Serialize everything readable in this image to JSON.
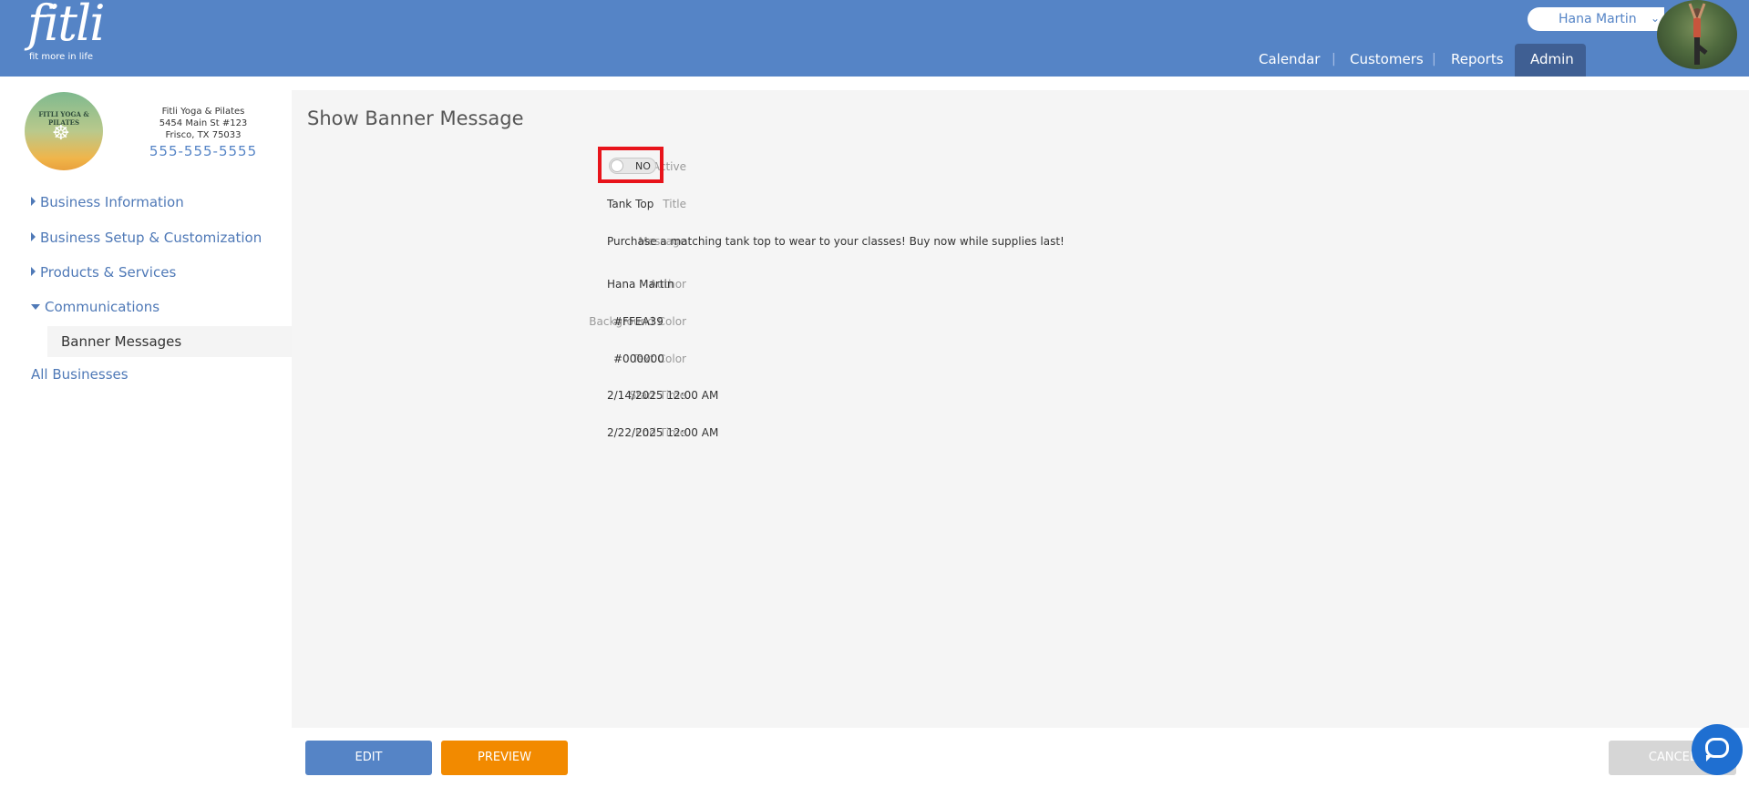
{
  "header": {
    "logo_text": "fitli",
    "logo_tagline": "fit more in life",
    "user_name": "Hana Martin",
    "user_chevron": "⌄",
    "nav": [
      {
        "label": "Calendar"
      },
      {
        "label": "Customers"
      },
      {
        "label": "Reports"
      },
      {
        "label": "Admin",
        "active": true
      }
    ],
    "nav_separator": "|"
  },
  "sidebar": {
    "business_name": "Fitli Yoga & Pilates",
    "address_line1": "5454 Main St #123",
    "address_line2": "Frisco, TX 75033",
    "phone": "555-555-5555",
    "logo_text": "FITLI YOGA & PILATES",
    "items": [
      {
        "label": "Business Information",
        "expanded": false
      },
      {
        "label": "Business Setup & Customization",
        "expanded": false
      },
      {
        "label": "Products & Services",
        "expanded": false
      },
      {
        "label": "Communications",
        "expanded": true
      },
      {
        "label": "Banner Messages",
        "selected": true
      },
      {
        "label": "All Businesses"
      }
    ]
  },
  "main": {
    "title": "Show Banner Message",
    "fields": {
      "active_label": "Active",
      "active_value": "NO",
      "title_label": "Title",
      "title_value": "Tank Top",
      "message_label": "Message",
      "message_value": "Purchase a matching tank top to wear to your classes! Buy now while supplies last!",
      "author_label": "Author",
      "author_value": "Hana Martin",
      "bg_color_label": "Background Color",
      "bg_color_value": "#FFEA39",
      "text_color_label": "Text Color",
      "text_color_value": "#000000",
      "start_label": "Start Time",
      "start_value": "2/14/2025 12:00 AM",
      "end_label": "End Time",
      "end_value": "2/22/2025 12:00 AM"
    }
  },
  "footer": {
    "edit_label": "EDIT",
    "preview_label": "PREVIEW",
    "cancel_label": "CANCEL"
  },
  "colors": {
    "brand": "#5584c6",
    "accent": "#f28a00",
    "highlight": "#e8141b"
  },
  "icons": {
    "chat": "chat-bubble-icon",
    "arrow_right": "triangle-right-icon",
    "arrow_down": "triangle-down-icon"
  }
}
